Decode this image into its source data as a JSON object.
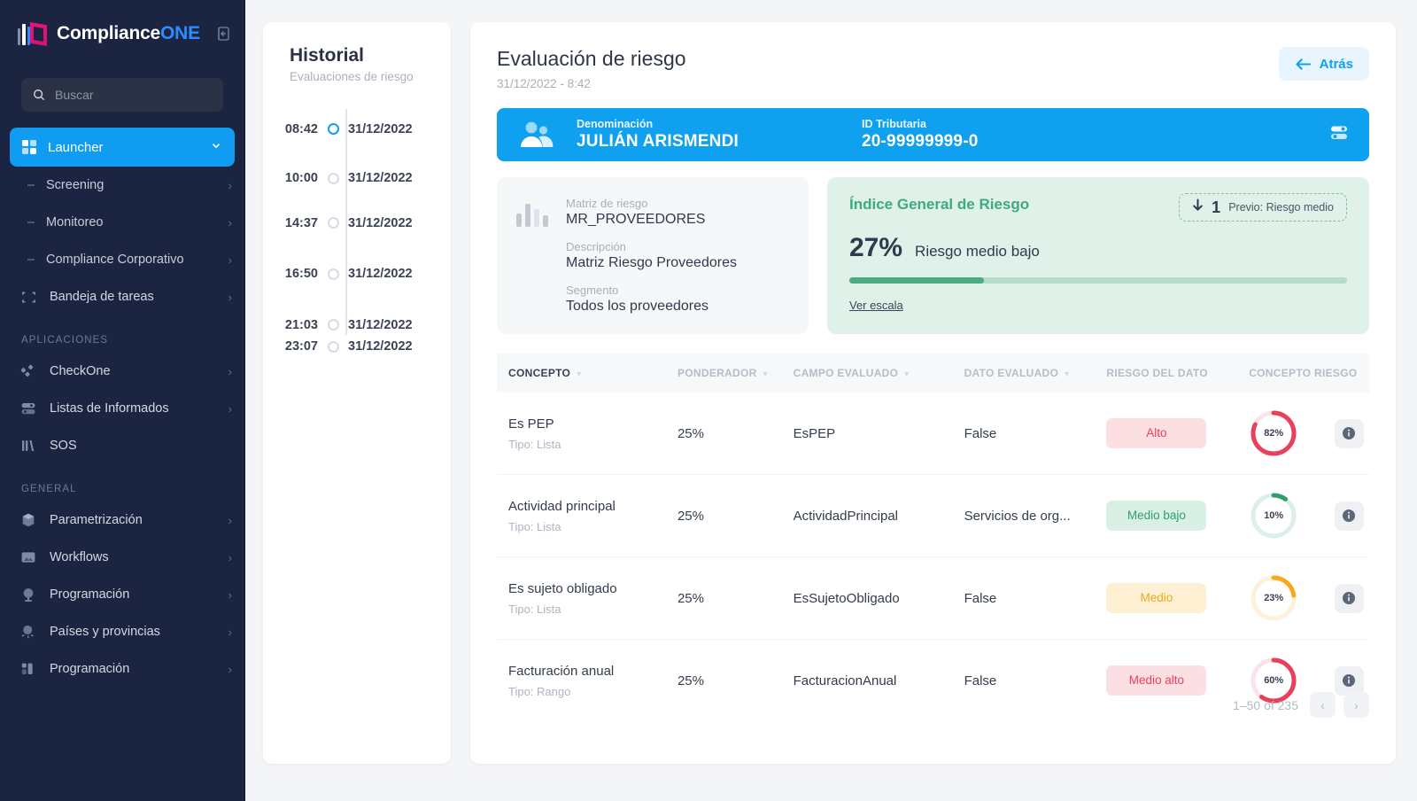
{
  "brand": {
    "name_1": "Compliance",
    "name_2": "ONE",
    "collapse_icon": "collapse-panel-icon"
  },
  "search": {
    "placeholder": "Buscar",
    "value": "",
    "icon": "search-icon"
  },
  "sidebar": {
    "active": {
      "label": "Launcher",
      "icon": "grid-icon",
      "chevron": "chevron-down-icon"
    },
    "sub_items": [
      {
        "label": "Screening"
      },
      {
        "label": "Monitoreo"
      },
      {
        "label": "Compliance Corporativo"
      }
    ],
    "items_top": [
      {
        "label": "Bandeja de tareas",
        "icon": "frame-icon"
      }
    ],
    "section_apps": "APLICACIONES",
    "items_apps": [
      {
        "label": "CheckOne",
        "icon": "diamonds-icon"
      },
      {
        "label": "Listas de Informados",
        "icon": "toggles-icon"
      },
      {
        "label": "SOS",
        "icon": "bars-icon"
      }
    ],
    "section_general": "GENERAL",
    "items_general": [
      {
        "label": "Parametrización",
        "icon": "cube-icon"
      },
      {
        "label": "Workflows",
        "icon": "image-icon"
      },
      {
        "label": "Programación",
        "icon": "globe-icon"
      },
      {
        "label": "Países y provincias",
        "icon": "map-pin-icon"
      },
      {
        "label": "Programación",
        "icon": "layout-icon"
      }
    ]
  },
  "history": {
    "title": "Historial",
    "subtitle": "Evaluaciones de riesgo",
    "entries": [
      {
        "time": "08:42",
        "date": "31/12/2022",
        "selected": true
      },
      {
        "time": "10:00",
        "date": "31/12/2022",
        "selected": false
      },
      {
        "time": "14:37",
        "date": "31/12/2022",
        "selected": false
      },
      {
        "time": "16:50",
        "date": "31/12/2022",
        "selected": false
      },
      {
        "time": "21:03",
        "date": "31/12/2022",
        "selected": false
      },
      {
        "time": "23:07",
        "date": "31/12/2022",
        "selected": false
      }
    ]
  },
  "page": {
    "title": "Evaluación de riesgo",
    "date": "31/12/2022 - 8:42",
    "back_label": "Atrás",
    "back_icon": "arrow-left-icon"
  },
  "banner": {
    "avatar_icon": "users-icon",
    "settings_icon": "list-settings-icon",
    "fields": [
      {
        "label": "Denominación",
        "value": "JULIÁN ARISMENDI"
      },
      {
        "label": "ID Tributaria",
        "value": "20-99999999-0"
      }
    ]
  },
  "matrix": {
    "icon": "bar-chart-icon",
    "fields": [
      {
        "label": "Matriz de riesgo",
        "value": "MR_PROVEEDORES"
      },
      {
        "label": "Descripción",
        "value": "Matriz Riesgo Proveedores"
      },
      {
        "label": "Segmento",
        "value": "Todos los proveedores"
      }
    ]
  },
  "risk": {
    "title": "Índice General de Riesgo",
    "percent_label": "27%",
    "percent_value": 27,
    "level": "Riesgo medio bajo",
    "link": "Ver escala",
    "prev": {
      "arrow": "arrow-down-icon",
      "delta": "1",
      "text": "Previo: Riesgo medio"
    },
    "colors": {
      "bg": "#dff1e8",
      "accent": "#4cab82",
      "track": "#b4ddc9",
      "title": "#3fa980"
    }
  },
  "table": {
    "columns": [
      {
        "label": "CONCEPTO",
        "sortable": true
      },
      {
        "label": "PONDERADOR",
        "sortable": true
      },
      {
        "label": "CAMPO EVALUADO",
        "sortable": true
      },
      {
        "label": "DATO EVALUADO",
        "sortable": true
      },
      {
        "label": "RIESGO DEL DATO",
        "sortable": false
      },
      {
        "label": "CONCEPTO RIESGO",
        "sortable": false
      }
    ],
    "rows": [
      {
        "concepto": "Es PEP",
        "tipo": "Tipo: Lista",
        "ponderador": "25%",
        "campo": "EsPEP",
        "dato": "False",
        "riesgo": "Alto",
        "riesgo_bg": "#fcdfe3",
        "riesgo_fg": "#e8415c",
        "pct_label": "82%",
        "pct": 82,
        "ring": "#e8415c",
        "ring_track": "#fbe3e7",
        "info_icon": "info-icon"
      },
      {
        "concepto": "Actividad principal",
        "tipo": "Tipo: Lista",
        "ponderador": "25%",
        "campo": "ActividadPrincipal",
        "dato": "Servicios de org...",
        "riesgo": "Medio bajo",
        "riesgo_bg": "#d9f0e4",
        "riesgo_fg": "#2fa06d",
        "pct_label": "10%",
        "pct": 10,
        "ring": "#2fa06d",
        "ring_track": "#ddf0e6",
        "info_icon": "info-icon"
      },
      {
        "concepto": "Es sujeto obligado",
        "tipo": "Tipo: Lista",
        "ponderador": "25%",
        "campo": "EsSujetoObligado",
        "dato": "False",
        "riesgo": "Medio",
        "riesgo_bg": "#fdf0d3",
        "riesgo_fg": "#f0a81e",
        "pct_label": "23%",
        "pct": 23,
        "ring": "#f9a81c",
        "ring_track": "#fdf1da",
        "info_icon": "info-icon"
      },
      {
        "concepto": "Facturación anual",
        "tipo": "Tipo: Rango",
        "ponderador": "25%",
        "campo": "FacturacionAnual",
        "dato": "False",
        "riesgo": "Medio alto",
        "riesgo_bg": "#fcdfe3",
        "riesgo_fg": "#e8415c",
        "pct_label": "60%",
        "pct": 60,
        "ring": "#e8415c",
        "ring_track": "#fbe3e7",
        "info_icon": "info-icon"
      }
    ],
    "pagination": {
      "count": "1–50 of 235",
      "prev": "‹",
      "next": "›"
    }
  },
  "theme": {
    "accent": "#109cf1",
    "sidebar_bg": "#1b2440",
    "page_bg": "#f4f5f7"
  }
}
